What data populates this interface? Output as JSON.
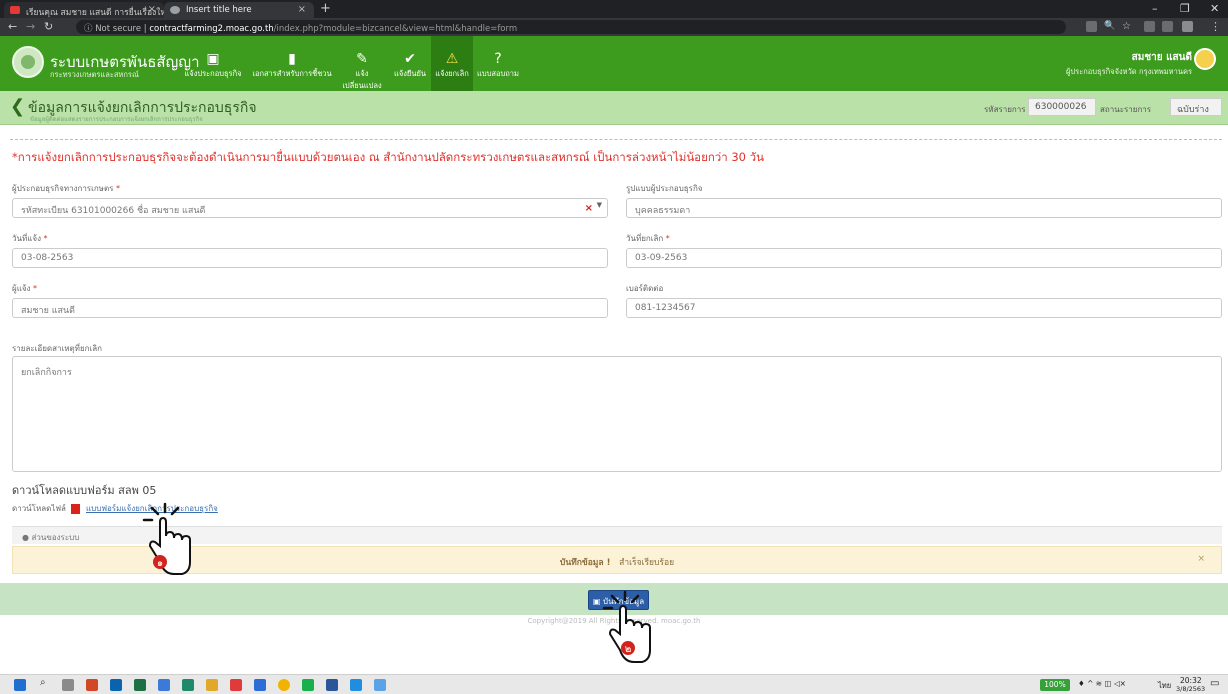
{
  "browser": {
    "tab1_title": "เรียนคุณ สมชาย แสนดี การยื่นเรื่องใหม่",
    "tab2_title": "Insert title here",
    "not_secure": "Not secure",
    "url_host": "contractfarming2.moac.go.th",
    "url_path": "/index.php?module=bizcancel&view=html&handle=form"
  },
  "header": {
    "system_title": "ระบบเกษตรพันธสัญญา",
    "system_sub": "กระทรวงเกษตรและสหกรณ์",
    "menu": [
      {
        "label": "แจ้งประกอบธุรกิจ",
        "icon": "▣"
      },
      {
        "label": "เอกสารสำหรับการชี้ชวน",
        "icon": "▮"
      },
      {
        "label": "แจ้งเปลี่ยนแปลง",
        "icon": "✎"
      },
      {
        "label": "แจ้งยืนยัน",
        "icon": "✔"
      },
      {
        "label": "แจ้งยกเลิก",
        "icon": "⚠"
      },
      {
        "label": "แบบสอบถาม",
        "icon": "?"
      }
    ],
    "user_name": "สมชาย แสนดี",
    "user_role": "ผู้ประกอบธุรกิจจังหวัด กรุงเทพมหานคร"
  },
  "page": {
    "title": "ข้อมูลการแจ้งยกเลิกการประกอบธุรกิจ",
    "subtitle": "ข้อมูลผู้ติดต่อแสดงรายการประกอบการแจ้งยกเลิกการประกอบธุรกิจ",
    "ref_label": "รหัสรายการ",
    "ref_value": "630000026",
    "status_label": "สถานะรายการ",
    "status_value": "ฉบับร่าง"
  },
  "form": {
    "warning": "*การแจ้งยกเลิกการประกอบธุรกิจจะต้องดำเนินการมายื่นแบบด้วยตนเอง ณ สำนักงานปลัดกระทรวงเกษตรและสหกรณ์ เป็นการล่วงหน้าไม่น้อยกว่า 30 วัน",
    "operator_label": "ผู้ประกอบธุรกิจทางการเกษตร",
    "operator_value": "รหัสทะเบียน 63101000266 ชื่อ สมชาย แสนดี",
    "biz_type_label": "รูปแบบผู้ประกอบธุรกิจ",
    "biz_type_value": "บุคคลธรรมดา",
    "notify_date_label": "วันที่แจ้ง",
    "notify_date_value": "03-08-2563",
    "cancel_date_label": "วันที่ยกเลิก",
    "cancel_date_value": "03-09-2563",
    "notifier_label": "ผู้แจ้ง",
    "notifier_value": "สมชาย แสนดี",
    "phone_label": "เบอร์ติดต่อ",
    "phone_value": "081-1234567",
    "reason_label": "รายละเอียดสาเหตุที่ยกเลิก",
    "reason_value": "ยกเลิกกิจการ",
    "required_mark": "*"
  },
  "download": {
    "title": "ดาวน์โหลดแบบฟอร์ม สลพ 05",
    "file_label": "ดาวน์โหลดไฟล์",
    "file_link": "แบบฟอร์มแจ้งยกเลิกการประกอบธุรกิจ"
  },
  "system_section": "ส่วนของระบบ",
  "alert": {
    "bold": "บันทึกข้อมูล !",
    "text": "สำเร็จเรียบร้อย",
    "close": "×"
  },
  "save_button": "บันทึกข้อมูล",
  "copyright": "Copyright@2019 All Rights Reserved. moac.go.th",
  "hand_markers": [
    {
      "number": "๑"
    },
    {
      "number": "๒"
    }
  ],
  "taskbar": {
    "zoom": "100%",
    "lang": "ไทย",
    "time": "20:32",
    "date": "3/8/2563"
  },
  "colors": {
    "header_green": "#3d9b1d",
    "warning_red": "#e0312a",
    "save_blue": "#2c5fa8"
  }
}
